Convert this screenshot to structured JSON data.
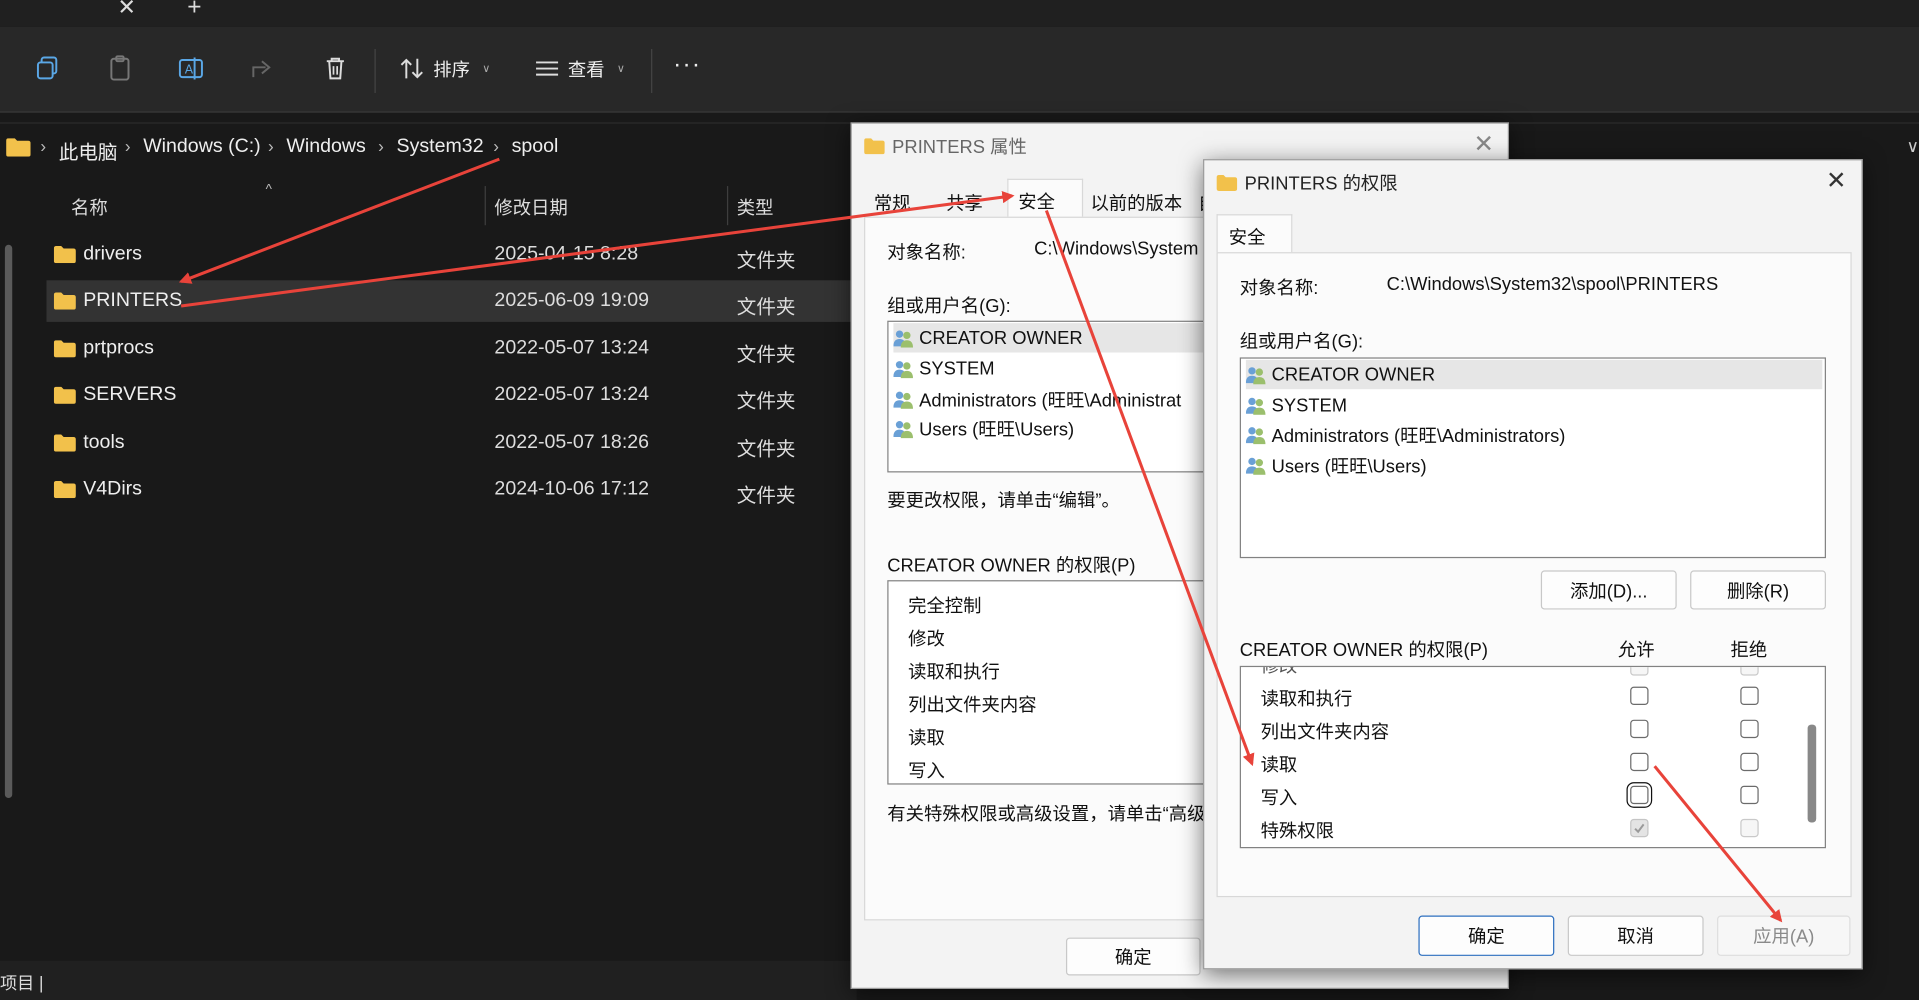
{
  "explorer": {
    "toolbar": {
      "sort_label": "排序",
      "view_label": "查看",
      "more_label": "···"
    },
    "breadcrumb": [
      "此电脑",
      "Windows (C:)",
      "Windows",
      "System32",
      "spool"
    ],
    "columns": {
      "name": "名称",
      "date": "修改日期",
      "type": "类型"
    },
    "files": [
      {
        "name": "drivers",
        "date": "2025-04-15 8:28",
        "type": "文件夹"
      },
      {
        "name": "PRINTERS",
        "date": "2025-06-09 19:09",
        "type": "文件夹"
      },
      {
        "name": "prtprocs",
        "date": "2022-05-07 13:24",
        "type": "文件夹"
      },
      {
        "name": "SERVERS",
        "date": "2022-05-07 13:24",
        "type": "文件夹"
      },
      {
        "name": "tools",
        "date": "2022-05-07 18:26",
        "type": "文件夹"
      },
      {
        "name": "V4Dirs",
        "date": "2024-10-06 17:12",
        "type": "文件夹"
      }
    ],
    "status_text": "项目 |"
  },
  "props_dialog": {
    "title": "PRINTERS 属性",
    "tabs": [
      "常规",
      "共享",
      "安全",
      "以前的版本",
      "自"
    ],
    "object_label": "对象名称:",
    "object_value": "C:\\Windows\\System",
    "group_label": "组或用户名(G):",
    "users": [
      "CREATOR OWNER",
      "SYSTEM",
      "Administrators (旺旺\\Administrat",
      "Users (旺旺\\Users)"
    ],
    "edit_hint": "要更改权限，请单击“编辑”。",
    "perm_label": "CREATOR OWNER 的权限(P)",
    "perms": [
      "完全控制",
      "修改",
      "读取和执行",
      "列出文件夹内容",
      "读取",
      "写入"
    ],
    "advanced_hint": "有关特殊权限或高级设置，请单击“高级”",
    "ok_label": "确定"
  },
  "perm_dialog": {
    "title": "PRINTERS 的权限",
    "tab": "安全",
    "object_label": "对象名称:",
    "object_value": "C:\\Windows\\System32\\spool\\PRINTERS",
    "group_label": "组或用户名(G):",
    "users": [
      "CREATOR OWNER",
      "SYSTEM",
      "Administrators (旺旺\\Administrators)",
      "Users (旺旺\\Users)"
    ],
    "add_label": "添加(D)...",
    "remove_label": "删除(R)",
    "perm_label": "CREATOR OWNER 的权限(P)",
    "allow_label": "允许",
    "deny_label": "拒绝",
    "perms": [
      {
        "name": "修改",
        "allow": false,
        "deny": false
      },
      {
        "name": "读取和执行",
        "allow": false,
        "deny": false
      },
      {
        "name": "列出文件夹内容",
        "allow": false,
        "deny": false
      },
      {
        "name": "读取",
        "allow": false,
        "deny": false
      },
      {
        "name": "写入",
        "allow": false,
        "deny": false
      },
      {
        "name": "特殊权限",
        "allow": true,
        "deny": false
      }
    ],
    "ok_label": "确定",
    "cancel_label": "取消",
    "apply_label": "应用(A)"
  },
  "annotation_color": "#e8433a"
}
